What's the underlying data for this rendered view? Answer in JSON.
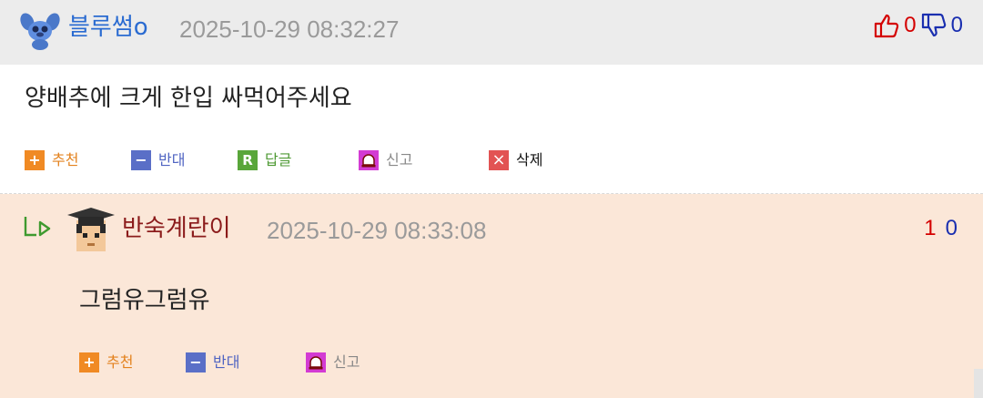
{
  "comment": {
    "author": "블루썸o",
    "timestamp": "2025-10-29 08:32:27",
    "up_count": "0",
    "down_count": "0",
    "body": "양배추에 크게 한입 싸먹어주세요",
    "actions": {
      "recommend": "추천",
      "oppose": "반대",
      "reply": "답글",
      "report": "신고",
      "delete": "삭제"
    }
  },
  "reply": {
    "author": "반숙계란이",
    "timestamp": "2025-10-29 08:33:08",
    "up_count": "1",
    "down_count": "0",
    "body": "그럼유그럼유",
    "actions": {
      "recommend": "추천",
      "oppose": "반대",
      "report": "신고"
    }
  },
  "colors": {
    "header_bg": "#ececec",
    "reply_bg": "#fbe7d8",
    "author_blue": "#2a6bd1",
    "author_red": "#8b1b1b",
    "up_red": "#d40000",
    "down_blue": "#1a2fb0"
  },
  "icons": {
    "avatar1": "stitch-avatar-icon",
    "avatar2": "graduate-avatar-icon",
    "thumb_up": "thumb-up-icon",
    "thumb_down": "thumb-down-icon",
    "reply_arrow": "reply-arrow-icon"
  }
}
